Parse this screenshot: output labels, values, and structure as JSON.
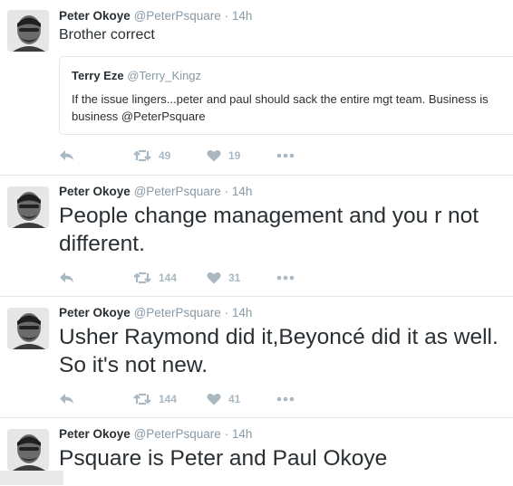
{
  "tweets": [
    {
      "name": "Peter Okoye",
      "handle": "@PeterPsquare",
      "dot": "·",
      "time": "14h",
      "text": "Brother correct",
      "quote": {
        "name": "Terry Eze",
        "handle": "@Terry_Kingz",
        "text": "If the issue lingers...peter and paul should sack the entire mgt team. Business is business @PeterPsquare"
      },
      "retweets": "49",
      "likes": "19"
    },
    {
      "name": "Peter Okoye",
      "handle": "@PeterPsquare",
      "dot": "·",
      "time": "14h",
      "text": "People change management and you r not different.",
      "retweets": "144",
      "likes": "31"
    },
    {
      "name": "Peter Okoye",
      "handle": "@PeterPsquare",
      "dot": "·",
      "time": "14h",
      "text": "Usher Raymond did it,Beyoncé did it as well. So it's not new.",
      "retweets": "144",
      "likes": "41"
    },
    {
      "name": "Peter Okoye",
      "handle": "@PeterPsquare",
      "dot": "·",
      "time": "14h",
      "text": "Psquare is Peter and Paul Okoye"
    }
  ],
  "icons": {
    "reply": "reply-icon",
    "retweet": "retweet-icon",
    "like": "heart-icon",
    "more": "more-icon"
  },
  "colors": {
    "text": "#292f33",
    "muted": "#8899a6",
    "action": "#aab8c2",
    "border": "#e1e8ed"
  }
}
